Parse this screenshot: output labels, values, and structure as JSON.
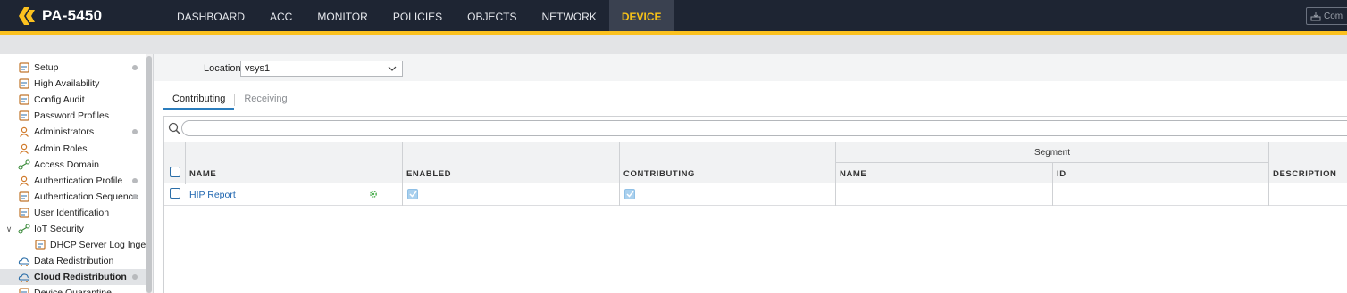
{
  "app": {
    "title": "PA-5450"
  },
  "nav": {
    "tabs": [
      "DASHBOARD",
      "ACC",
      "MONITOR",
      "POLICIES",
      "OBJECTS",
      "NETWORK",
      "DEVICE"
    ],
    "active": "DEVICE",
    "commit_label": "Com"
  },
  "sidebar": {
    "items": [
      {
        "label": "Setup",
        "icon": "setup-icon",
        "dot": true
      },
      {
        "label": "High Availability",
        "icon": "high-availability-icon",
        "dot": false
      },
      {
        "label": "Config Audit",
        "icon": "config-audit-icon",
        "dot": false
      },
      {
        "label": "Password Profiles",
        "icon": "password-profiles-icon",
        "dot": false
      },
      {
        "label": "Administrators",
        "icon": "administrators-icon",
        "dot": true
      },
      {
        "label": "Admin Roles",
        "icon": "admin-roles-icon",
        "dot": false
      },
      {
        "label": "Access Domain",
        "icon": "access-domain-icon",
        "dot": false
      },
      {
        "label": "Authentication Profile",
        "icon": "authentication-profile-icon",
        "dot": true
      },
      {
        "label": "Authentication Sequence",
        "icon": "authentication-sequence-icon",
        "dot": true
      },
      {
        "label": "User Identification",
        "icon": "user-identification-icon",
        "dot": false
      },
      {
        "label": "IoT Security",
        "icon": "iot-security-icon",
        "dot": false,
        "expanded": true
      },
      {
        "label": "DHCP Server Log Ingest",
        "icon": "dhcp-log-icon",
        "dot": false,
        "child": true
      },
      {
        "label": "Data Redistribution",
        "icon": "data-redistribution-icon",
        "dot": false
      },
      {
        "label": "Cloud Redistribution",
        "icon": "cloud-redistribution-icon",
        "dot": true,
        "selected": true
      },
      {
        "label": "Device Quarantine",
        "icon": "device-quarantine-icon",
        "dot": false
      }
    ]
  },
  "location": {
    "label": "Location",
    "value": "vsys1"
  },
  "subtabs": {
    "items": [
      "Contributing",
      "Receiving"
    ],
    "active": "Contributing"
  },
  "search": {
    "placeholder": ""
  },
  "table": {
    "columns": {
      "name": "NAME",
      "enabled": "ENABLED",
      "contributing": "CONTRIBUTING",
      "segment_group": "Segment",
      "segment_name": "NAME",
      "segment_id": "ID",
      "description": "DESCRIPTION"
    },
    "rows": [
      {
        "name": "HIP Report",
        "enabled": true,
        "contributing": true,
        "segment_name": "",
        "segment_id": "",
        "description": ""
      }
    ]
  },
  "colors": {
    "topbar": "#1e2533",
    "accent": "#fbc11f",
    "active_tab_text": "#f5c119",
    "link": "#1f66b0"
  }
}
